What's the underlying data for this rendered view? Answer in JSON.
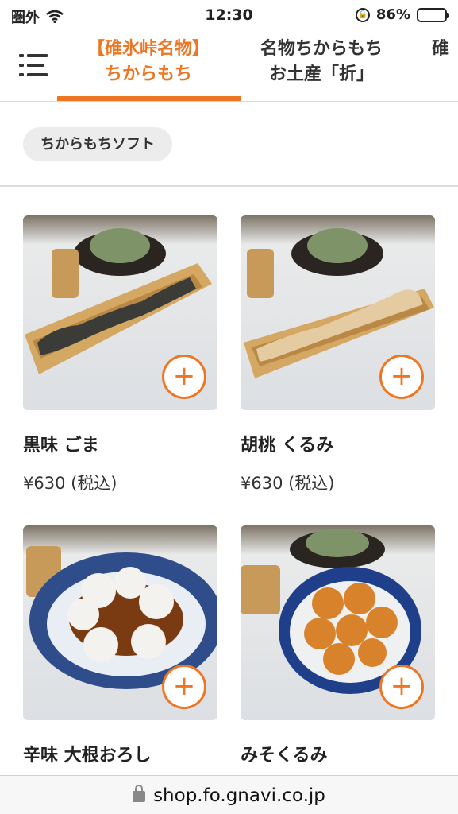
{
  "status_bar": {
    "carrier": "圏外",
    "time": "12:30",
    "battery_percent": "86%",
    "battery_level": 0.86,
    "icons": [
      "wifi-icon",
      "orientation-lock-icon",
      "battery-icon"
    ]
  },
  "tabs": [
    {
      "label": "【碓氷峠名物】\nちからもち",
      "active": true
    },
    {
      "label": "名物ちからもち\nお土産「折」",
      "active": false
    },
    {
      "label": "碓",
      "active": false
    }
  ],
  "accent_color": "#ee7623",
  "chip": {
    "label": "ちからもちソフト"
  },
  "products": [
    {
      "name": "黒味 ごま",
      "price": "¥630 (税込)"
    },
    {
      "name": "胡桃 くるみ",
      "price": "¥630 (税込)"
    },
    {
      "name": "辛味 大根おろし",
      "price": ""
    },
    {
      "name": "みそくるみ",
      "price": ""
    }
  ],
  "add_button_label": "+",
  "url_bar": {
    "url": "shop.fo.gnavi.co.jp",
    "icon": "lock-icon"
  }
}
